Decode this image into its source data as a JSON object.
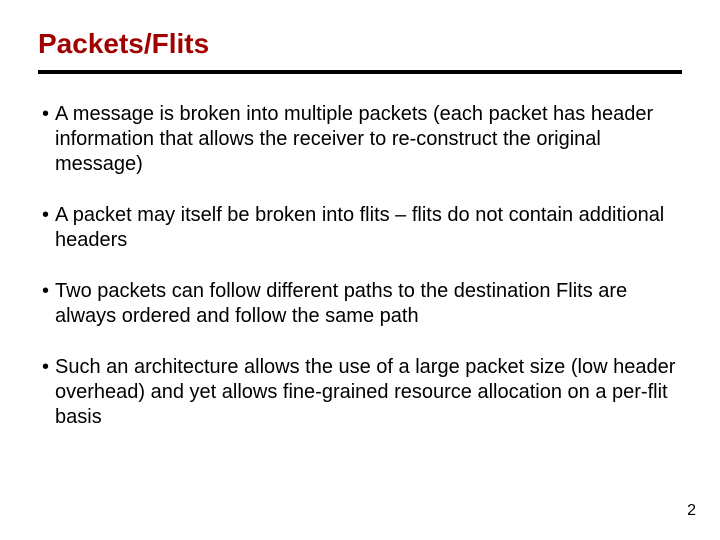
{
  "slide": {
    "title": "Packets/Flits",
    "bullets": [
      "A message is broken into multiple packets (each packet has header information that allows the receiver to re-construct the original message)",
      "A packet may itself be broken into flits – flits do not contain additional headers",
      "Two packets can follow different paths to the destination Flits are always ordered and follow the same path",
      "Such an architecture allows the use of a large packet size (low header overhead) and yet allows fine-grained resource allocation on a per-flit basis"
    ],
    "page_number": "2",
    "bullet_marker": "•"
  }
}
